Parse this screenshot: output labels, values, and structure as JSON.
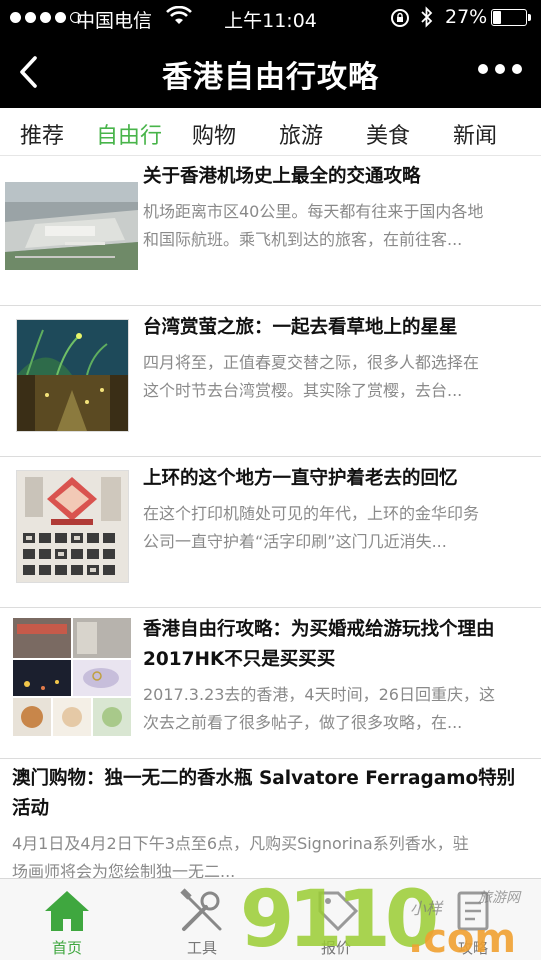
{
  "status_bar": {
    "carrier": "中国电信",
    "time": "上午11:04",
    "battery_text": "27%",
    "battery_level": 0.27
  },
  "nav": {
    "title": "香港自由行攻略"
  },
  "tabs": [
    {
      "label": "推荐"
    },
    {
      "label": "自由行"
    },
    {
      "label": "购物"
    },
    {
      "label": "旅游"
    },
    {
      "label": "美食"
    },
    {
      "label": "新闻"
    }
  ],
  "active_tab": "自由行",
  "articles": [
    {
      "title": "关于香港机场史上最全的交通攻略",
      "desc1": "机场距离市区40公里。每天都有往来于国内各地",
      "desc2": "和国际航班。乘飞机到达的旅客，在前往客..."
    },
    {
      "title": "台湾赏萤之旅：一起去看草地上的星星",
      "desc1": "四月将至，正值春夏交替之际，很多人都选择在",
      "desc2": "这个时节去台湾赏樱。其实除了赏樱，去台..."
    },
    {
      "title": "上环的这个地方一直守护着老去的回忆",
      "desc1": "在这个打印机随处可见的年代，上环的金华印务",
      "desc2": "公司一直守护着“活字印刷”这门几近消失..."
    },
    {
      "title1": "香港自由行攻略：为买婚戒给游玩找个理由",
      "title2": "2017HK不只是买买买",
      "desc1": "2017.3.23去的香港，4天时间，26日回重庆，这",
      "desc2": "次去之前看了很多帖子，做了很多攻略，在..."
    },
    {
      "title1": "澳门购物：独一无二的香水瓶 Salvatore Ferragamo特别",
      "title2": "活动",
      "desc1": "4月1日及4月2日下午3点至6点，凡购买Signorina系列香水，驻",
      "desc2": "场画师将会为您绘制独一无二..."
    }
  ],
  "tab_bar": [
    {
      "label": "首页",
      "icon": "home-icon"
    },
    {
      "label": "工具",
      "icon": "tools-icon"
    },
    {
      "label": "报价",
      "icon": "price-tag-icon"
    },
    {
      "label": "攻略",
      "icon": "guide-icon"
    }
  ],
  "watermark": {
    "brand": "9110",
    "domain": ".com",
    "slogan": "小样 旅游网"
  },
  "colors": {
    "accent": "#48b44a",
    "nav_bg": "#000000",
    "desc_text": "#8a8a8a"
  }
}
